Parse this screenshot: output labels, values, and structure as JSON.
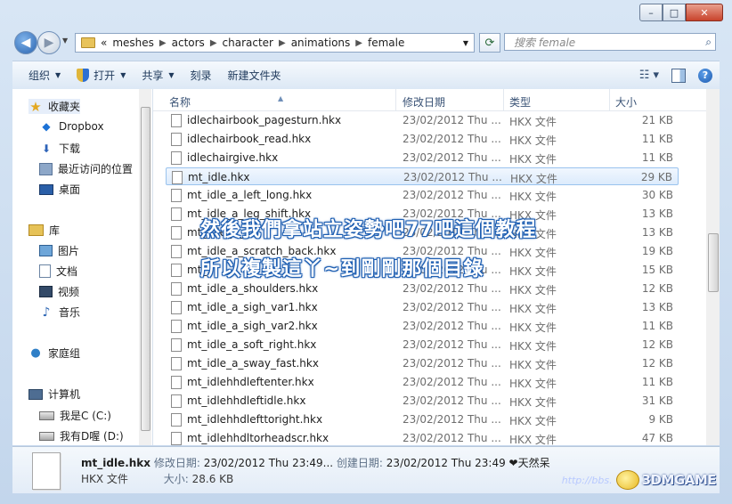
{
  "window": {
    "controls": {
      "minimize": "–",
      "maximize": "□",
      "close": "✕"
    }
  },
  "address": {
    "prefix": "«",
    "crumbs": [
      "meshes",
      "actors",
      "character",
      "animations",
      "female"
    ],
    "search_placeholder": "搜索 female"
  },
  "toolbar": {
    "organize": "组织",
    "open": "打开",
    "share": "共享",
    "burn": "刻录",
    "new_folder": "新建文件夹",
    "help": "?"
  },
  "nav": {
    "favorites": "收藏夹",
    "dropbox": "Dropbox",
    "downloads": "下载",
    "recent": "最近访问的位置",
    "desktop": "桌面",
    "libraries": "库",
    "pictures": "图片",
    "documents": "文档",
    "videos": "视频",
    "music": "音乐",
    "homegroup": "家庭组",
    "computer": "计算机",
    "drive_c": "我是C (C:)",
    "drive_d": "我有D喔 (D:)"
  },
  "columns": {
    "name": "名称",
    "date": "修改日期",
    "type": "类型",
    "size": "大小"
  },
  "files": [
    {
      "name": "idlechairbook_pagesturn.hkx",
      "date": "23/02/2012 Thu ...",
      "type": "HKX 文件",
      "size": "21 KB"
    },
    {
      "name": "idlechairbook_read.hkx",
      "date": "23/02/2012 Thu ...",
      "type": "HKX 文件",
      "size": "11 KB"
    },
    {
      "name": "idlechairgive.hkx",
      "date": "23/02/2012 Thu ...",
      "type": "HKX 文件",
      "size": "11 KB"
    },
    {
      "name": "mt_idle.hkx",
      "date": "23/02/2012 Thu ...",
      "type": "HKX 文件",
      "size": "29 KB"
    },
    {
      "name": "mt_idle_a_left_long.hkx",
      "date": "23/02/2012 Thu ...",
      "type": "HKX 文件",
      "size": "30 KB"
    },
    {
      "name": "mt_idle_a_leg_shift.hkx",
      "date": "23/02/2012 Thu ...",
      "type": "HKX 文件",
      "size": "13 KB"
    },
    {
      "name": "mt_idle_a_...",
      "date": "23/02/2012 Thu ...",
      "type": "HKX 文件",
      "size": "13 KB"
    },
    {
      "name": "mt_idle_a_scratch_back.hkx",
      "date": "23/02/2012 Thu ...",
      "type": "HKX 文件",
      "size": "19 KB"
    },
    {
      "name": "mt_...",
      "date": "23/02/2012 Thu ...",
      "type": "HKX 文件",
      "size": "15 KB"
    },
    {
      "name": "mt_idle_a_shoulders.hkx",
      "date": "23/02/2012 Thu ...",
      "type": "HKX 文件",
      "size": "12 KB"
    },
    {
      "name": "mt_idle_a_sigh_var1.hkx",
      "date": "23/02/2012 Thu ...",
      "type": "HKX 文件",
      "size": "13 KB"
    },
    {
      "name": "mt_idle_a_sigh_var2.hkx",
      "date": "23/02/2012 Thu ...",
      "type": "HKX 文件",
      "size": "11 KB"
    },
    {
      "name": "mt_idle_a_soft_right.hkx",
      "date": "23/02/2012 Thu ...",
      "type": "HKX 文件",
      "size": "12 KB"
    },
    {
      "name": "mt_idle_a_sway_fast.hkx",
      "date": "23/02/2012 Thu ...",
      "type": "HKX 文件",
      "size": "12 KB"
    },
    {
      "name": "mt_idlehhdleftenter.hkx",
      "date": "23/02/2012 Thu ...",
      "type": "HKX 文件",
      "size": "11 KB"
    },
    {
      "name": "mt_idlehhdleftidle.hkx",
      "date": "23/02/2012 Thu ...",
      "type": "HKX 文件",
      "size": "31 KB"
    },
    {
      "name": "mt_idlehhdlefttoright.hkx",
      "date": "23/02/2012 Thu ...",
      "type": "HKX 文件",
      "size": "9 KB"
    },
    {
      "name": "mt_idlehhdltorheadscr.hkx",
      "date": "23/02/2012 Thu ...",
      "type": "HKX 文件",
      "size": "47 KB"
    }
  ],
  "overlay": {
    "line1": "然後我們拿站立姿勢吧77吧這個教程",
    "line2": "所以複製這丫~到剛剛那個目錄"
  },
  "details": {
    "filename": "mt_idle.hkx",
    "modified_label": "修改日期:",
    "modified_value": "23/02/2012 Thu 23:49...",
    "created_label": "创建日期:",
    "created_value": "23/02/2012 Thu 23:49",
    "extra": "❤天然呆",
    "type": "HKX 文件",
    "size_label": "大小:",
    "size_value": "28.6 KB"
  },
  "watermark": {
    "url": "http://bbs.",
    "logo": "3DMGAME"
  }
}
